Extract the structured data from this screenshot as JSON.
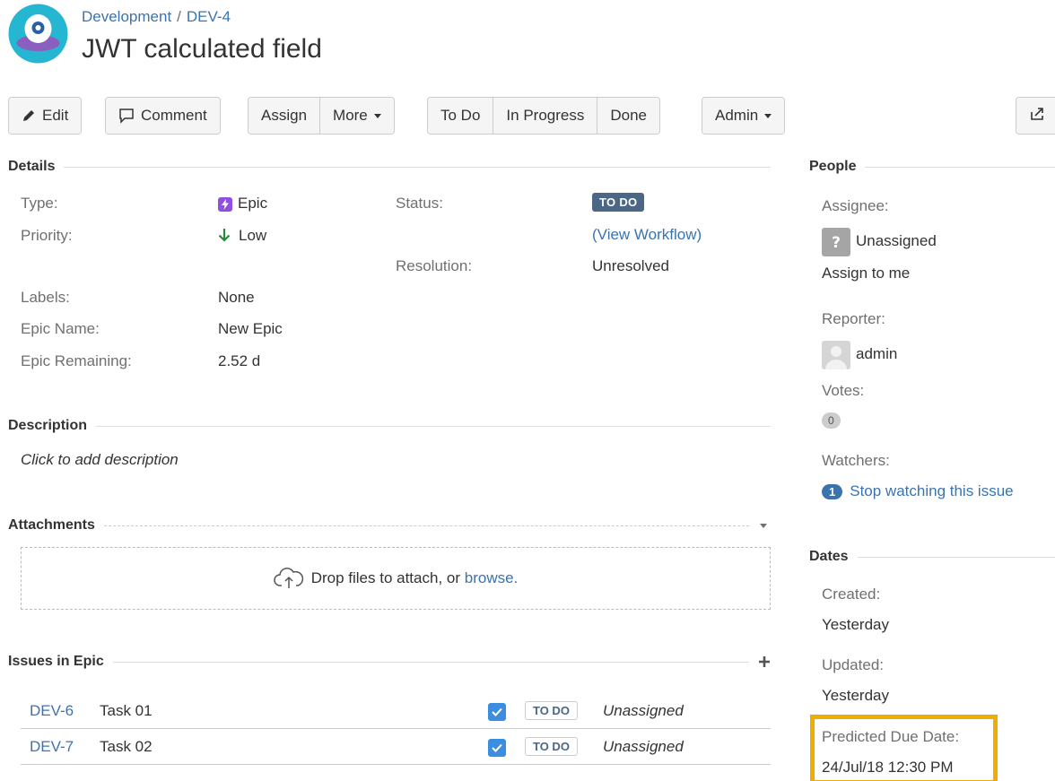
{
  "breadcrumb": {
    "project": "Development",
    "separator": "/",
    "issue_key": "DEV-4"
  },
  "issue": {
    "title": "JWT calculated field"
  },
  "toolbar": {
    "edit": "Edit",
    "comment": "Comment",
    "assign": "Assign",
    "more": "More",
    "todo": "To Do",
    "in_progress": "In Progress",
    "done": "Done",
    "admin": "Admin"
  },
  "details": {
    "heading": "Details",
    "type_label": "Type:",
    "type_value": "Epic",
    "priority_label": "Priority:",
    "priority_value": "Low",
    "status_label": "Status:",
    "status_value": "TO DO",
    "view_workflow": "(View Workflow)",
    "resolution_label": "Resolution:",
    "resolution_value": "Unresolved",
    "labels_label": "Labels:",
    "labels_value": "None",
    "epic_name_label": "Epic Name:",
    "epic_name_value": "New Epic",
    "epic_remaining_label": "Epic Remaining:",
    "epic_remaining_value": "2.52 d"
  },
  "description": {
    "heading": "Description",
    "placeholder": "Click to add description"
  },
  "attachments": {
    "heading": "Attachments",
    "drop_text": "Drop files to attach, or",
    "browse": "browse."
  },
  "issues_in_epic": {
    "heading": "Issues in Epic",
    "rows": [
      {
        "key": "DEV-6",
        "summary": "Task 01",
        "status": "TO DO",
        "assignee": "Unassigned"
      },
      {
        "key": "DEV-7",
        "summary": "Task 02",
        "status": "TO DO",
        "assignee": "Unassigned"
      }
    ]
  },
  "people": {
    "heading": "People",
    "assignee_label": "Assignee:",
    "assignee_value": "Unassigned",
    "assign_to_me": "Assign to me",
    "reporter_label": "Reporter:",
    "reporter_value": "admin",
    "votes_label": "Votes:",
    "votes_count": "0",
    "watchers_label": "Watchers:",
    "watchers_count": "1",
    "stop_watching": "Stop watching this issue"
  },
  "dates": {
    "heading": "Dates",
    "created_label": "Created:",
    "created_value": "Yesterday",
    "updated_label": "Updated:",
    "updated_value": "Yesterday",
    "predicted_label": "Predicted Due Date:",
    "predicted_value": "24/Jul/18 12:30 PM"
  },
  "colors": {
    "link": "#3b73af",
    "status_todo": "#4a6785",
    "highlight": "#f0ad00",
    "epic": "#904ee2"
  }
}
